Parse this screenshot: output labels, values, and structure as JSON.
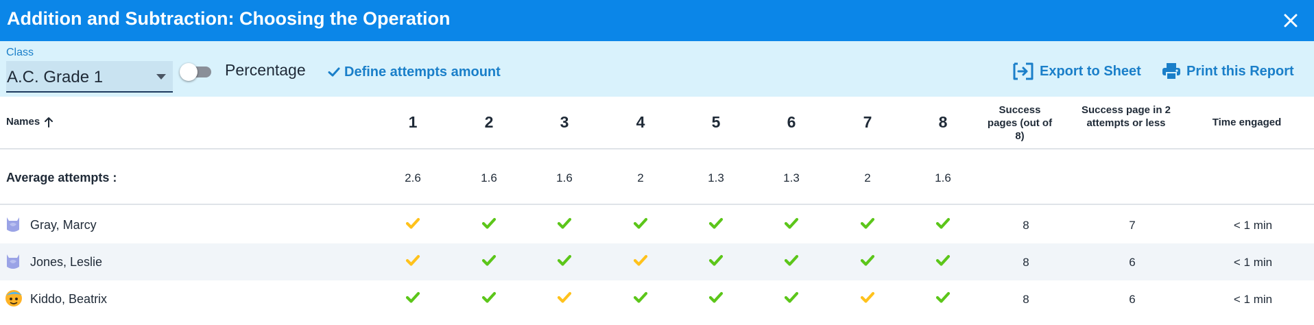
{
  "window": {
    "title": "Addition and Subtraction: Choosing the Operation",
    "close_icon": "close-icon",
    "header_color": "#0b86e8"
  },
  "toolbar": {
    "class_label": "Class",
    "class_value": "A.C. Grade 1",
    "percentage_label": "Percentage",
    "percentage_on": false,
    "define_attempts_label": "Define attempts amount",
    "export_label": "Export to Sheet",
    "print_label": "Print this Report",
    "accent_color": "#1a7fc9"
  },
  "table": {
    "names_header": "Names",
    "sort_icon": "arrow-up-icon",
    "pages": [
      "1",
      "2",
      "3",
      "4",
      "5",
      "6",
      "7",
      "8"
    ],
    "summary_headers": {
      "success_pages": "Success pages (out of 8)",
      "success_in_two": "Success page in 2 attempts or less",
      "time_engaged": "Time engaged"
    },
    "average": {
      "label": "Average attempts :",
      "values": [
        "2.6",
        "1.6",
        "1.6",
        "2",
        "1.3",
        "1.3",
        "2",
        "1.6"
      ]
    },
    "status_colors": {
      "green": "#5cc61a",
      "yellow": "#ffc21c"
    },
    "students": [
      {
        "name": "Gray, Marcy",
        "avatar": "owl-avatar",
        "marks": [
          "yellow",
          "green",
          "green",
          "green",
          "green",
          "green",
          "green",
          "green"
        ],
        "success_pages": "8",
        "success_in_two": "7",
        "time_engaged": "< 1 min"
      },
      {
        "name": "Jones, Leslie",
        "avatar": "owl-avatar",
        "marks": [
          "yellow",
          "green",
          "green",
          "yellow",
          "green",
          "green",
          "green",
          "green"
        ],
        "success_pages": "8",
        "success_in_two": "6",
        "time_engaged": "< 1 min"
      },
      {
        "name": "Kiddo, Beatrix",
        "avatar": "sun-face-avatar",
        "marks": [
          "green",
          "green",
          "yellow",
          "green",
          "green",
          "green",
          "yellow",
          "green"
        ],
        "success_pages": "8",
        "success_in_two": "6",
        "time_engaged": "< 1 min"
      }
    ]
  }
}
